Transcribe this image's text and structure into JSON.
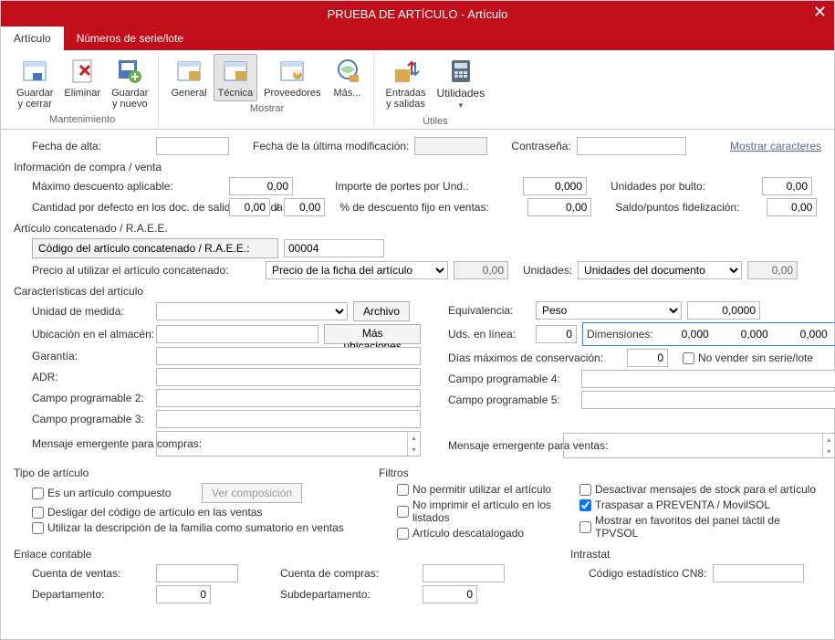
{
  "window": {
    "title": "PRUEBA DE ARTÍCULO - Artículo"
  },
  "tabs": {
    "articulo": "Artículo",
    "series": "Números de serie/lote"
  },
  "ribbon": {
    "maint": {
      "group": "Mantenimiento",
      "save_close": "Guardar\ny cerrar",
      "delete": "Eliminar",
      "save_new": "Guardar\ny nuevo"
    },
    "show": {
      "group": "Mostrar",
      "general": "General",
      "tecnica": "Técnica",
      "prov": "Proveedores",
      "mas": "Más..."
    },
    "utils": {
      "group": "Útiles",
      "entsal": "Entradas\ny salidas",
      "util": "Utilidades"
    }
  },
  "f": {
    "fecha_alta": "Fecha de alta:",
    "fecha_mod": "Fecha de la última modificación:",
    "contrasena": "Contraseña:",
    "mostrar_car": "Mostrar caracteres",
    "sec_compra": "Información de compra / venta",
    "max_desc": "Máximo descuento aplicable:",
    "max_desc_v": "0,00",
    "cant_def": "Cantidad por defecto en los doc. de salida / entrada:",
    "cant_def_v1": "0,00",
    "cant_def_v2": "0,00",
    "imp_port": "Importe de portes por Und.:",
    "imp_port_v": "0,000",
    "pct_desc": "% de descuento fijo en ventas:",
    "pct_desc_v": "0,00",
    "und_bulto": "Unidades por bulto:",
    "und_bulto_v": "0,00",
    "saldo": "Saldo/puntos fidelización:",
    "saldo_v": "0,00",
    "sec_concat": "Artículo concatenado / R.A.E.E.",
    "cod_concat": "Código del artículo concatenado / R.A.E.E.:",
    "cod_concat_v": "00004",
    "precio_concat": "Precio al utilizar el artículo concatenado:",
    "precio_concat_sel": "Precio de la ficha del artículo",
    "precio_concat_v": "0,00",
    "unidades": "Unidades:",
    "unidades_sel": "Unidades del documento",
    "unidades_v": "0,00",
    "sec_caract": "Características del artículo",
    "unidad_med": "Unidad de medida:",
    "archivo": "Archivo",
    "ubicacion": "Ubicación en el almacén:",
    "mas_ubic": "Más ubicaciones",
    "garantia": "Garantía:",
    "adr": "ADR:",
    "cp2": "Campo programable 2:",
    "cp3": "Campo programable 3:",
    "msg_comp": "Mensaje emergente para compras:",
    "equiv": "Equivalencia:",
    "equiv_sel": "Peso",
    "equiv_v": "0,0000",
    "uds_linea": "Uds. en línea:",
    "uds_linea_v": "0",
    "dimensiones": "Dimensiones:",
    "dim1": "0,000",
    "dim2": "0,000",
    "dim3": "0,000",
    "dias_max": "Días máximos de conservación:",
    "dias_max_v": "0",
    "no_vender": "No vender sin serie/lote",
    "cp4": "Campo programable 4:",
    "cp5": "Campo programable 5:",
    "msg_vent": "Mensaje emergente para ventas:",
    "sec_tipo": "Tipo de artículo",
    "es_comp": "Es un artículo compuesto",
    "ver_comp": "Ver composición",
    "desligar": "Desligar del código de artículo en las ventas",
    "util_desc": "Utilizar la descripción de la familia como sumatorio en ventas",
    "sec_filtros": "Filtros",
    "no_permitir": "No permitir utilizar el artículo",
    "no_imprimir": "No imprimir el artículo en los listados",
    "descatalogado": "Artículo descatalogado",
    "desac_stock": "Desactivar mensajes de stock para el artículo",
    "traspasar": "Traspasar a PREVENTA / MovilSOL",
    "favoritos": "Mostrar en favoritos del panel táctil de TPVSOL",
    "sec_enlace": "Enlace contable",
    "cta_ventas": "Cuenta de ventas:",
    "cta_compras": "Cuenta de compras:",
    "depto": "Departamento:",
    "depto_v": "0",
    "subdepto": "Subdepartamento:",
    "subdepto_v": "0",
    "sec_intra": "Intrastat",
    "cn8": "Código estadístico CN8:"
  }
}
